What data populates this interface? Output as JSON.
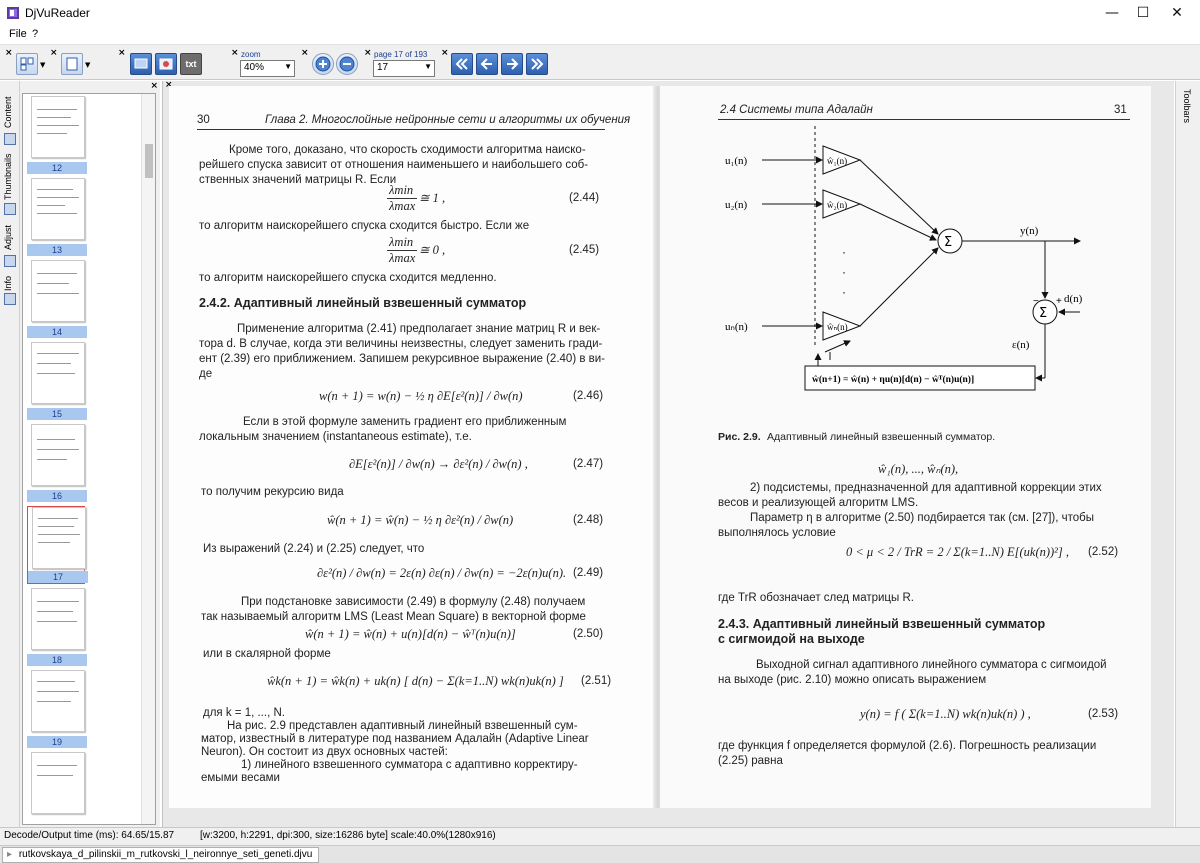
{
  "window": {
    "title": "DjVuReader",
    "minimize": "—",
    "maximize": "☐",
    "close": "✕"
  },
  "menu": {
    "file": "File",
    "help": "?"
  },
  "toolbar": {
    "zoom_label": "zoom",
    "zoom_value": "40%",
    "page_label": "page 17 of 193",
    "page_value": "17",
    "txt_label": "txt"
  },
  "sidebar": {
    "tabs": [
      "Content",
      "Thumbnails",
      "Adjust",
      "Info"
    ]
  },
  "thumbnails": [
    "12",
    "13",
    "14",
    "15",
    "16",
    "17",
    "18",
    "19"
  ],
  "toolbars_label": "Toolbars",
  "status": {
    "decode": "Decode/Output time (ms): 64.65/15.87",
    "info": "[w:3200, h:2291, dpi:300, size:16286 byte] scale:40.0%(1280x916)"
  },
  "file_tab": "rutkovskaya_d_pilinskii_m_rutkovski_l_neironnye_seti_geneti.djvu",
  "left_page": {
    "number": "30",
    "header": "Глава 2. Многослойные нейронные сети и алгоритмы их обучения",
    "lines": [
      "Кроме того, доказано, что скорость сходимости алгоритма наиско-",
      "рейшего спуска зависит от отношения наименьшего и наибольшего соб-",
      "ственных значений матрицы R. Если",
      "то алгоритм наискорейшего спуска сходится быстро. Если же",
      "то алгоритм наискорейшего спуска сходится медленно."
    ],
    "eq_244": {
      "top": "λmin",
      "bottom": "λmax",
      "tail": "≅ 1 ,",
      "num": "(2.44)"
    },
    "eq_245": {
      "top": "λmin",
      "bottom": "λmax",
      "tail": "≅ 0 ,",
      "num": "(2.45)"
    },
    "section": "2.4.2. Адаптивный линейный взвешенный сумматор",
    "p2": [
      "Применение алгоритма (2.41) предполагает знание матриц R и век-",
      "тора d. В случае, когда эти величины неизвестны, следует заменить гради-",
      "ент (2.39) его приближением. Запишем рекурсивное выражение (2.40) в ви-",
      "де"
    ],
    "eq_246": {
      "text": "w(n + 1) = w(n) − ½ η ∂E[ε²(n)] / ∂w(n)",
      "num": "(2.46)"
    },
    "p3": [
      "Если в этой формуле заменить градиент его приближенным",
      "локальным значением (instantaneous estimate), т.е."
    ],
    "eq_247": {
      "text": "∂E[ε²(n)] / ∂w(n) → ∂ε²(n) / ∂w(n) ,",
      "num": "(2.47)"
    },
    "p4": "то получим рекурсию вида",
    "eq_248": {
      "text": "ŵ(n + 1) = ŵ(n) − ½ η ∂ε²(n) / ∂w(n)",
      "num": "(2.48)"
    },
    "p5": "Из выражений (2.24) и (2.25) следует, что",
    "eq_249": {
      "text": "∂ε²(n) / ∂w(n) = 2ε(n) ∂ε(n) / ∂w(n) = −2ε(n)u(n).",
      "num": "(2.49)"
    },
    "p6": [
      "При подстановке зависимости (2.49) в формулу (2.48) получаем",
      "так называемый алгоритм LMS (Least Mean Square) в векторной форме"
    ],
    "eq_250": {
      "text": "ŵ(n + 1) = ŵ(n) + u(n)[d(n) − ŵᵀ(n)u(n)]",
      "num": "(2.50)"
    },
    "p7": "или в скалярной форме",
    "eq_251": {
      "text": "ŵk(n + 1) = ŵk(n) + uk(n) [ d(n) − Σ(k=1..N) wk(n)uk(n) ]",
      "num": "(2.51)"
    },
    "p8": [
      "для k = 1, ..., N.",
      "На рис. 2.9 представлен адаптивный линейный взвешенный сум-",
      "матор, известный в литературе под названием Адалайн (Adaptive Linear",
      "Neuron). Он состоит из двух основных частей:",
      "1) линейного взвешенного сумматора с адаптивно корректиру-",
      "емыми весами"
    ]
  },
  "right_page": {
    "number": "31",
    "header": "2.4 Системы типа Адалайн",
    "diagram": {
      "inputs": [
        "u₁(n)",
        "u₂(n)",
        "uₙ(n)"
      ],
      "weights": [
        "ŵ₁(n)",
        "ŵ₂(n)",
        "ŵₙ(n)"
      ],
      "output": "y(n)",
      "desired": "d(n)",
      "error": "ε(n)",
      "sum": "Σ",
      "plus": "+",
      "minus": "−",
      "update": "ŵ(n+1) = ŵ(n) + ηu(n)[d(n) − ŵᵀ(n)u(n)]"
    },
    "caption_bold": "Рис. 2.9.",
    "caption": "Адаптивный линейный взвешенный сумматор.",
    "weights_line": "ŵ₁(n), ..., ŵₙ(n),",
    "p1": [
      "2) подсистемы, предназначенной для адаптивной коррекции этих",
      "весов и реализующей алгоритм LMS.",
      "Параметр η в алгоритме (2.50) подбирается так (см. [27]), чтобы",
      "выполнялось условие"
    ],
    "eq_252": {
      "text": "0 < μ < 2 / TrR = 2 / Σ(k=1..N) E[(uk(n))²] ,",
      "num": "(2.52)"
    },
    "p2": "где TrR обозначает след матрицы R.",
    "section": [
      "2.4.3. Адаптивный линейный взвешенный сумматор",
      "с сигмоидой на выходе"
    ],
    "p3": [
      "Выходной сигнал адаптивного линейного сумматора с сигмоидой",
      "на выходе (рис. 2.10) можно описать выражением"
    ],
    "eq_253": {
      "text": "y(n) = f ( Σ(k=1..N) wk(n)uk(n) ) ,",
      "num": "(2.53)"
    },
    "p4": [
      "где функция f определяется формулой (2.6). Погрешность реализации",
      "(2.25) равна"
    ]
  }
}
